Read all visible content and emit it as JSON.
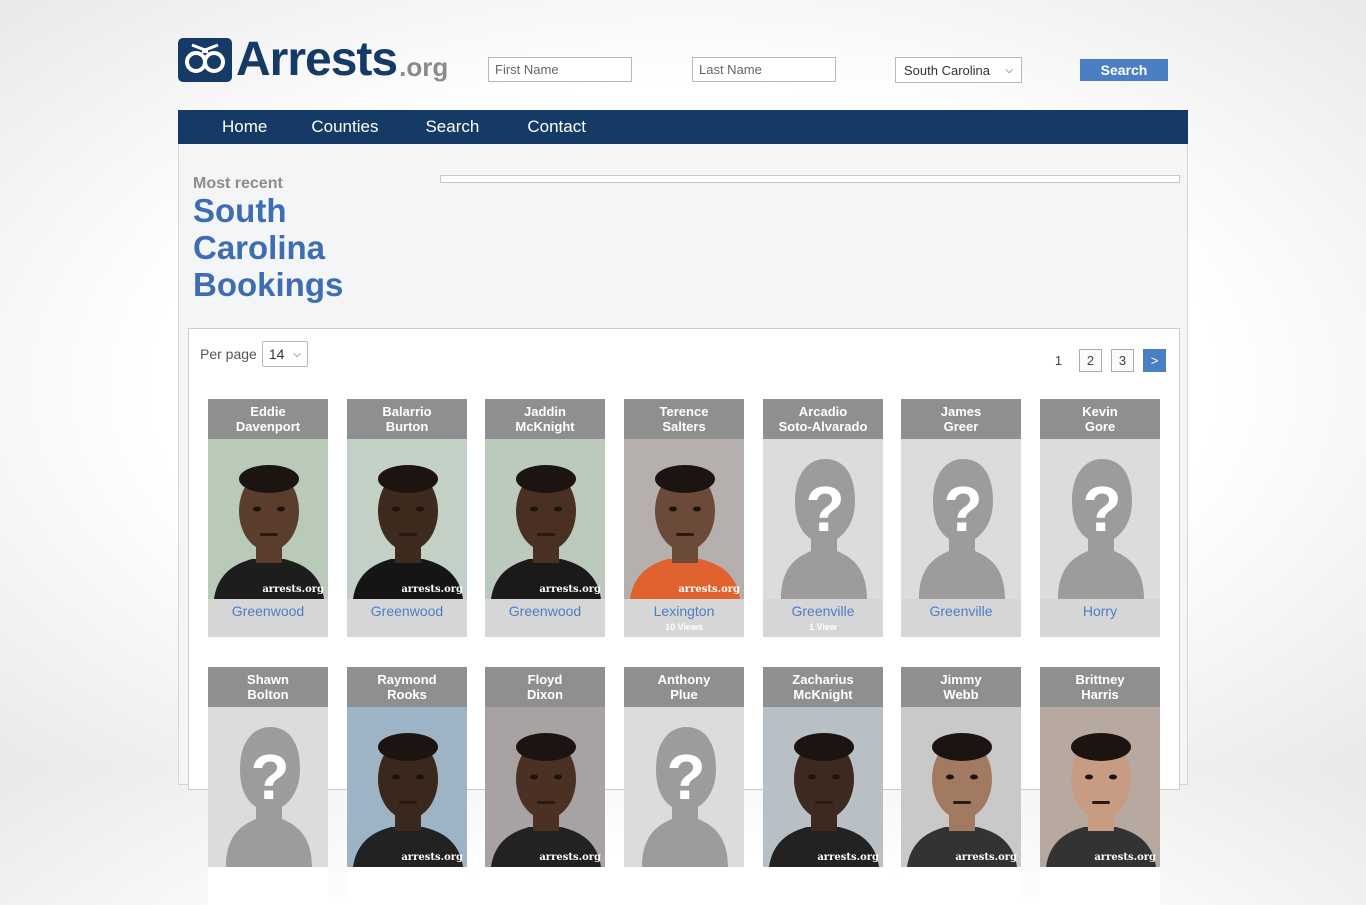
{
  "logo": {
    "name": "Arrests",
    "tld": ".org"
  },
  "search": {
    "first_placeholder": "First Name",
    "last_placeholder": "Last Name",
    "state_selected": "South Carolina",
    "button_label": "Search"
  },
  "nav": {
    "items": [
      "Home",
      "Counties",
      "Search",
      "Contact"
    ]
  },
  "heading": {
    "kicker": "Most recent",
    "line1": "South",
    "line2": "Carolina",
    "line3": "Bookings"
  },
  "per_page": {
    "label": "Per page",
    "value": "14"
  },
  "pager": {
    "current": "1",
    "pages": [
      "2",
      "3"
    ],
    "next": ">"
  },
  "watermark": "arrests.org",
  "row1": [
    {
      "first": "Eddie",
      "last": "Davenport",
      "county": "Greenwood",
      "views": ""
    },
    {
      "first": "Balarrio",
      "last": "Burton",
      "county": "Greenwood",
      "views": ""
    },
    {
      "first": "Jaddin",
      "last": "McKnight",
      "county": "Greenwood",
      "views": ""
    },
    {
      "first": "Terence",
      "last": "Salters",
      "county": "Lexington",
      "views": "10 Views"
    },
    {
      "first": "Arcadio",
      "last": "Soto-Alvarado",
      "county": "Greenville",
      "views": "1 View"
    },
    {
      "first": "James",
      "last": "Greer",
      "county": "Greenville",
      "views": ""
    },
    {
      "first": "Kevin",
      "last": "Gore",
      "county": "Horry",
      "views": ""
    }
  ],
  "row2": [
    {
      "first": "Shawn",
      "last": "Bolton"
    },
    {
      "first": "Raymond",
      "last": "Rooks"
    },
    {
      "first": "Floyd",
      "last": "Dixon"
    },
    {
      "first": "Anthony",
      "last": "Plue"
    },
    {
      "first": "Zacharius",
      "last": "McKnight"
    },
    {
      "first": "Jimmy",
      "last": "Webb"
    },
    {
      "first": "Brittney",
      "last": "Harris"
    }
  ],
  "colors": {
    "brand_navy": "#163a66",
    "link_blue": "#4a7fc4",
    "name_bar": "#8f8f8f"
  }
}
